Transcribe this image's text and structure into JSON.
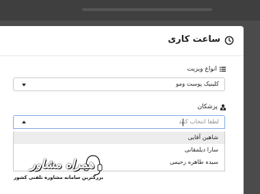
{
  "modal": {
    "title": "ساعت کاری",
    "visit_type_label": "انواع ویزیت",
    "visit_type_value": "کلینیک پوست ومو",
    "doctors_label": "پزشکان",
    "doctors_placeholder": "لطفا انتخاب کنید",
    "doctor_options": [
      "شاهین آقایی",
      "سارا دیلمقانی",
      "سیده طاهره رحیمی"
    ]
  },
  "watermark": {
    "title": "همراه مشاور",
    "subtitle": "بزرگترین سامانه مشاوره تلفنی کشور"
  },
  "colors": {
    "overlay": "#4b4b4b",
    "focus_border": "#7aa7e0",
    "highlight": "#ececec",
    "card_bg": "#142235"
  },
  "icons": [
    "clock-icon",
    "list-icon",
    "user-doctor-icon",
    "caret-down-icon",
    "caret-up-icon",
    "headset-icon"
  ]
}
